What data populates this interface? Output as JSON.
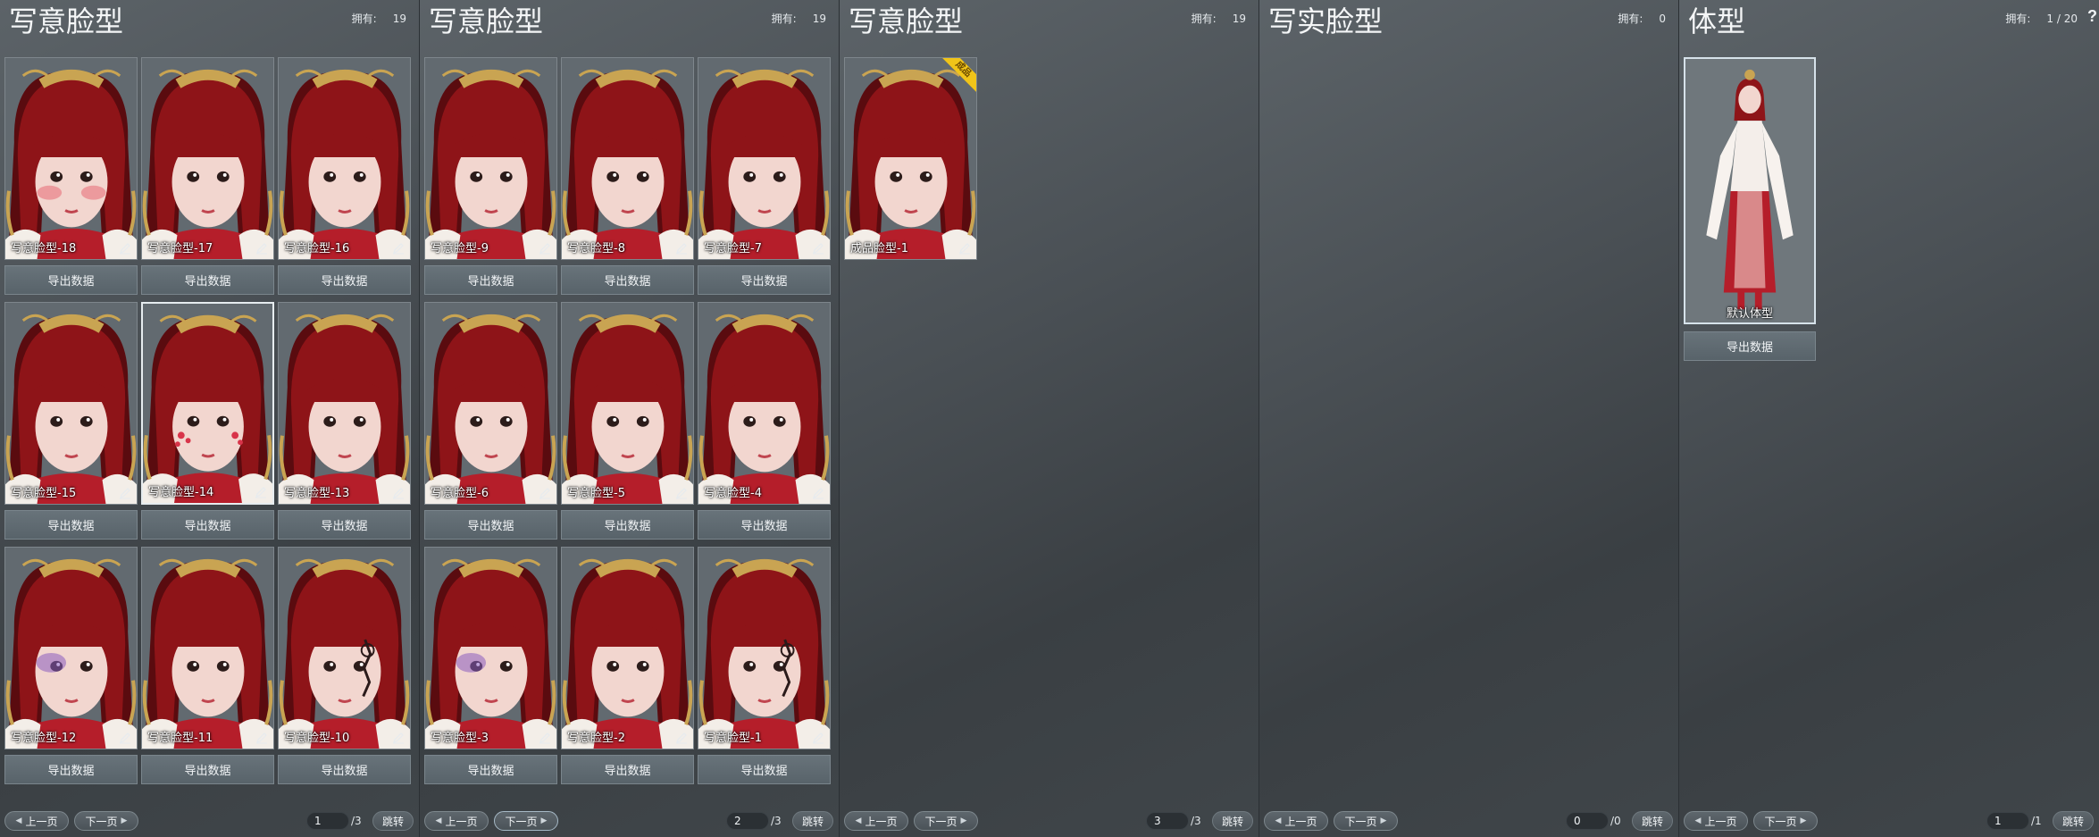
{
  "colors": {
    "hair": "#8e1418",
    "hair_dark": "#5a0b0f",
    "skin": "#f2d6cf",
    "ornament_gold": "#c9a452",
    "clothing_red": "#b51e2a",
    "badge_yellow": "#f0c419"
  },
  "icons": {
    "edit": "pencil-icon",
    "prev": "chevron-left-icon",
    "next": "chevron-right-icon",
    "help": "question-icon"
  },
  "panels": [
    {
      "title": "写意脸型",
      "owned_label": "拥有:",
      "owned_count": "19",
      "cards": [
        {
          "label": "写意脸型-18",
          "export": "导出数据",
          "face": "blush"
        },
        {
          "label": "写意脸型-17",
          "export": "导出数据",
          "face": "plain"
        },
        {
          "label": "写意脸型-16",
          "export": "导出数据",
          "face": "plain"
        },
        {
          "label": "写意脸型-15",
          "export": "导出数据",
          "face": "plain"
        },
        {
          "label": "写意脸型-14",
          "export": "导出数据",
          "face": "floral",
          "selected": true
        },
        {
          "label": "写意脸型-13",
          "export": "导出数据",
          "face": "plain"
        },
        {
          "label": "写意脸型-12",
          "export": "导出数据",
          "face": "purple"
        },
        {
          "label": "写意脸型-11",
          "export": "导出数据",
          "face": "plain"
        },
        {
          "label": "写意脸型-10",
          "export": "导出数据",
          "face": "tattoo"
        }
      ],
      "pager": {
        "prev": "上一页",
        "next": "下一页",
        "current": "1",
        "total": "/3",
        "jump": "跳转"
      }
    },
    {
      "title": "写意脸型",
      "owned_label": "拥有:",
      "owned_count": "19",
      "cards": [
        {
          "label": "写意脸型-9",
          "export": "导出数据",
          "face": "plain"
        },
        {
          "label": "写意脸型-8",
          "export": "导出数据",
          "face": "plain"
        },
        {
          "label": "写意脸型-7",
          "export": "导出数据",
          "face": "plain"
        },
        {
          "label": "写意脸型-6",
          "export": "导出数据",
          "face": "plain"
        },
        {
          "label": "写意脸型-5",
          "export": "导出数据",
          "face": "plain"
        },
        {
          "label": "写意脸型-4",
          "export": "导出数据",
          "face": "plain"
        },
        {
          "label": "写意脸型-3",
          "export": "导出数据",
          "face": "purple"
        },
        {
          "label": "写意脸型-2",
          "export": "导出数据",
          "face": "plain"
        },
        {
          "label": "写意脸型-1",
          "export": "导出数据",
          "face": "tattoo"
        }
      ],
      "pager": {
        "prev": "上一页",
        "next": "下一页",
        "current": "2",
        "total": "/3",
        "jump": "跳转"
      }
    },
    {
      "title": "写意脸型",
      "owned_label": "拥有:",
      "owned_count": "19",
      "cards": [
        {
          "label": "成品脸型-1",
          "face": "plain",
          "badge": "成品"
        }
      ],
      "pager": {
        "prev": "上一页",
        "next": "下一页",
        "current": "3",
        "total": "/3",
        "jump": "跳转"
      }
    },
    {
      "title": "写实脸型",
      "owned_label": "拥有:",
      "owned_count": "0",
      "cards": [],
      "pager": {
        "prev": "上一页",
        "next": "下一页",
        "current": "0",
        "total": "/0",
        "jump": "跳转"
      }
    },
    {
      "title": "体型",
      "owned_label": "拥有:",
      "owned_count": "1 / 20",
      "help": "?",
      "body_card": {
        "label": "默认体型",
        "export": "导出数据"
      },
      "pager": {
        "prev": "上一页",
        "next": "下一页",
        "current": "1",
        "total": "/1",
        "jump": "跳转"
      }
    }
  ]
}
